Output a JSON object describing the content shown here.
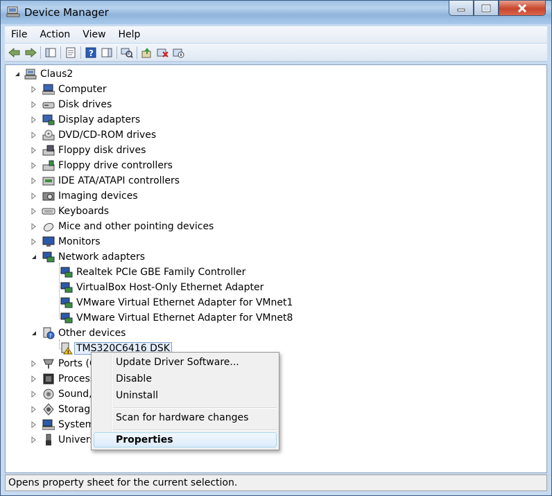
{
  "window": {
    "title": "Device Manager",
    "icon": "device-manager-icon"
  },
  "menu": [
    "File",
    "Action",
    "View",
    "Help"
  ],
  "toolbar": {
    "buttons": [
      "back-icon",
      "forward-icon",
      "show-hide-console-tree-icon",
      "properties-icon",
      "help-icon",
      "action-pane-icon",
      "scan-hardware-icon",
      "update-driver-icon",
      "uninstall-icon",
      "disable-icon"
    ]
  },
  "tree": {
    "root": "Claus2",
    "items": [
      {
        "label": "Computer",
        "icon": "computer-icon"
      },
      {
        "label": "Disk drives",
        "icon": "disk-drive-icon"
      },
      {
        "label": "Display adapters",
        "icon": "display-adapter-icon"
      },
      {
        "label": "DVD/CD-ROM drives",
        "icon": "dvd-drive-icon"
      },
      {
        "label": "Floppy disk drives",
        "icon": "floppy-disk-icon"
      },
      {
        "label": "Floppy drive controllers",
        "icon": "floppy-controller-icon"
      },
      {
        "label": "IDE ATA/ATAPI controllers",
        "icon": "ide-controller-icon"
      },
      {
        "label": "Imaging devices",
        "icon": "imaging-device-icon"
      },
      {
        "label": "Keyboards",
        "icon": "keyboard-icon"
      },
      {
        "label": "Mice and other pointing devices",
        "icon": "mouse-icon"
      },
      {
        "label": "Monitors",
        "icon": "monitor-icon"
      },
      {
        "label": "Network adapters",
        "icon": "network-adapter-icon"
      },
      {
        "label": "Realtek PCIe GBE Family Controller",
        "icon": "network-card-icon"
      },
      {
        "label": "VirtualBox Host-Only Ethernet Adapter",
        "icon": "network-card-icon"
      },
      {
        "label": "VMware Virtual Ethernet Adapter for VMnet1",
        "icon": "network-card-icon"
      },
      {
        "label": "VMware Virtual Ethernet Adapter for VMnet8",
        "icon": "network-card-icon"
      },
      {
        "label": "Other devices",
        "icon": "other-devices-icon"
      },
      {
        "label": "TMS320C6416 DSK",
        "icon": "unknown-device-warning-icon"
      },
      {
        "label": "Ports (C",
        "icon": "port-icon"
      },
      {
        "label": "Process",
        "icon": "processor-icon"
      },
      {
        "label": "Sound,",
        "icon": "sound-icon"
      },
      {
        "label": "Storag",
        "icon": "storage-controller-icon"
      },
      {
        "label": "System",
        "icon": "system-device-icon"
      },
      {
        "label": "Univers",
        "icon": "usb-controller-icon"
      }
    ]
  },
  "context_menu": {
    "items": [
      "Update Driver Software...",
      "Disable",
      "Uninstall",
      "Scan for hardware changes",
      "Properties"
    ]
  },
  "status": "Opens property sheet for the current selection."
}
